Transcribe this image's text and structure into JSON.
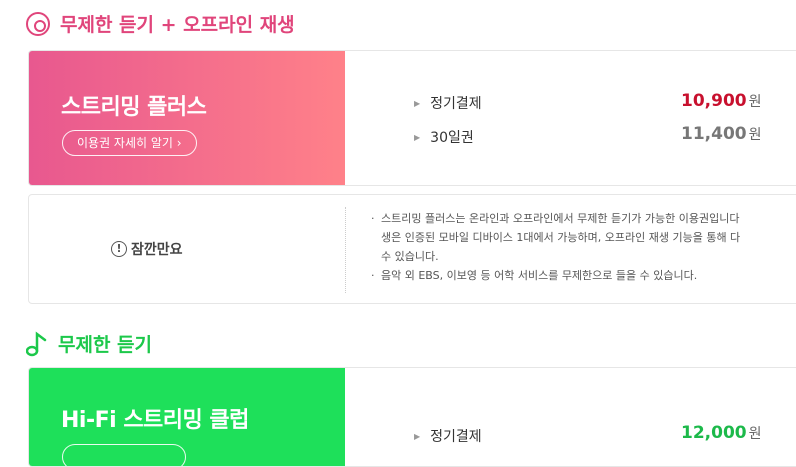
{
  "sections": {
    "offline": {
      "title": "무제한 듣기 + 오프라인 재생"
    },
    "unlimited": {
      "title": "무제한 듣기"
    }
  },
  "streaming_plus": {
    "name": "스트리밍 플러스",
    "detail_button": "이용권 자세히 알기 ›",
    "plans": [
      {
        "label": "정기결제",
        "price": "10,900",
        "unit": "원",
        "color": "#c8102e"
      },
      {
        "label": "30일권",
        "price": "11,400",
        "unit": "원",
        "color": "#777777"
      }
    ]
  },
  "notice": {
    "label": "잠깐만요",
    "lines": [
      "스트리밍 플러스는 온라인과 오프라인에서 무제한 듣기가 가능한 이용권입니다",
      "생은 인증된 모바일 디바이스 1대에서 가능하며, 오프라인 재생 기능을 통해 다",
      "수 있습니다.",
      "음악 외 EBS, 이보영 등 어학 서비스를 무제한으로 들을 수 있습니다."
    ]
  },
  "hifi_club": {
    "name": "Hi-Fi 스트리밍 클럽",
    "plans": [
      {
        "label": "정기결제",
        "price": "12,000",
        "unit": "원",
        "color": "#1cb94a"
      }
    ]
  },
  "colors": {
    "pink": "#e0457b",
    "green": "#1cc84a"
  },
  "icons": {
    "offline": "disc-icon",
    "unlimited": "music-note-icon",
    "notice": "exclamation-circle-icon"
  }
}
